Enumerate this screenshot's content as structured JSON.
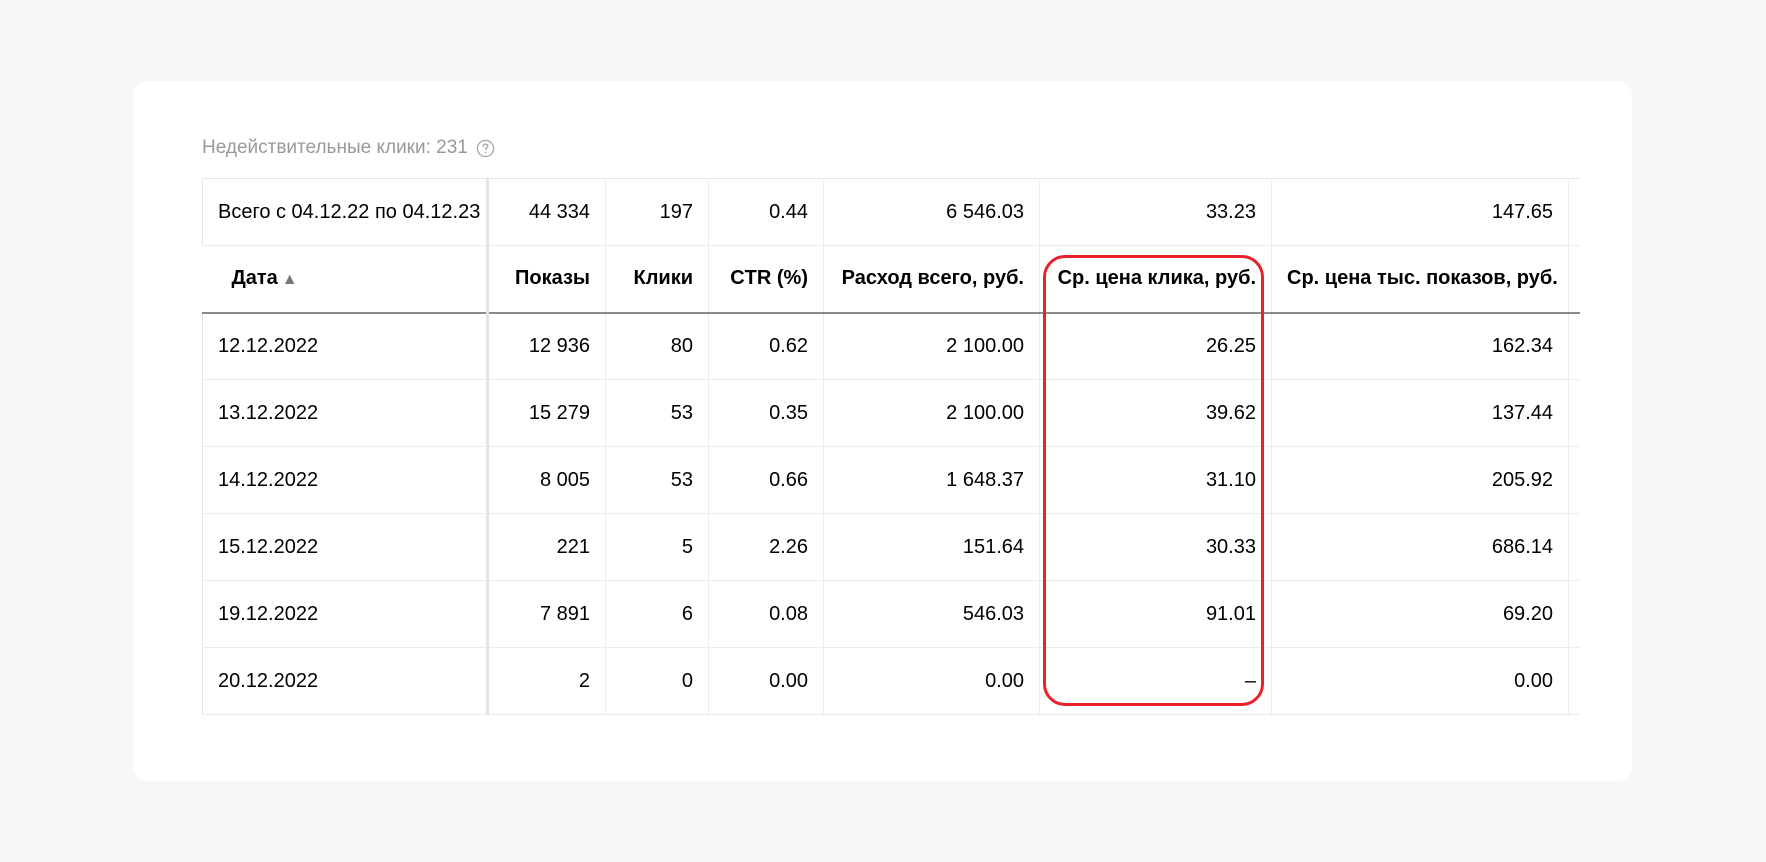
{
  "invalid_clicks": {
    "label": "Недействительные клики: 231",
    "help_icon": "question-circle-icon"
  },
  "table": {
    "total_row": {
      "label": "Всего с 04.12.22 по 04.12.23",
      "shows": "44 334",
      "clicks": "197",
      "ctr": "0.44",
      "spend": "6 546.03",
      "cpc": "33.23",
      "cpm": "147.65"
    },
    "columns": {
      "date": "Дата",
      "shows": "Показы",
      "clicks": "Клики",
      "ctr": "CTR (%)",
      "spend": "Расход всего, руб.",
      "cpc": "Ср. цена клика, руб.",
      "cpm": "Ср. цена тыс. показов, руб."
    },
    "sort_indicator": "▲",
    "rows": [
      {
        "date": "12.12.2022",
        "shows": "12 936",
        "clicks": "80",
        "ctr": "0.62",
        "spend": "2 100.00",
        "cpc": "26.25",
        "cpm": "162.34"
      },
      {
        "date": "13.12.2022",
        "shows": "15 279",
        "clicks": "53",
        "ctr": "0.35",
        "spend": "2 100.00",
        "cpc": "39.62",
        "cpm": "137.44"
      },
      {
        "date": "14.12.2022",
        "shows": "8 005",
        "clicks": "53",
        "ctr": "0.66",
        "spend": "1 648.37",
        "cpc": "31.10",
        "cpm": "205.92"
      },
      {
        "date": "15.12.2022",
        "shows": "221",
        "clicks": "5",
        "ctr": "2.26",
        "spend": "151.64",
        "cpc": "30.33",
        "cpm": "686.14"
      },
      {
        "date": "19.12.2022",
        "shows": "7 891",
        "clicks": "6",
        "ctr": "0.08",
        "spend": "546.03",
        "cpc": "91.01",
        "cpm": "69.20"
      },
      {
        "date": "20.12.2022",
        "shows": "2",
        "clicks": "0",
        "ctr": "0.00",
        "spend": "0.00",
        "cpc": "–",
        "cpm": "0.00"
      }
    ]
  },
  "highlight_color": "#e8212b"
}
